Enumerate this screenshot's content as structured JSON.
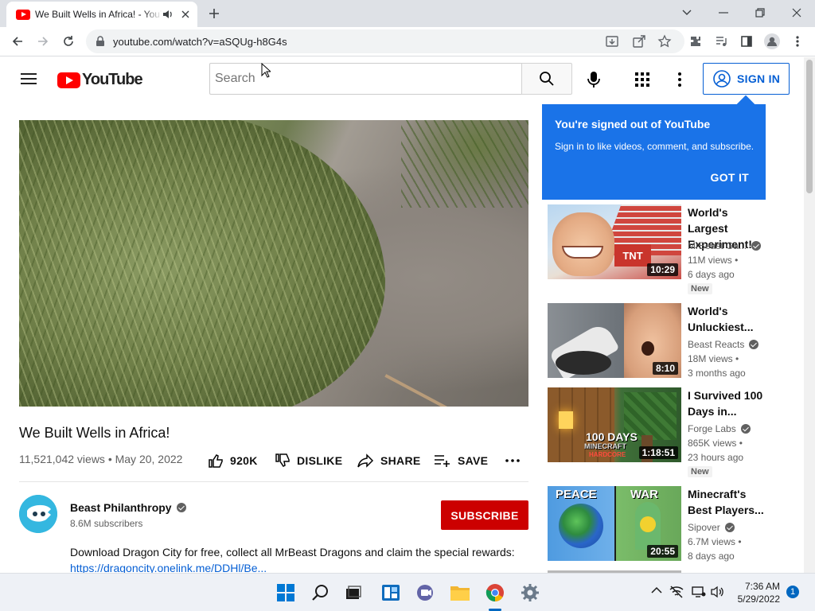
{
  "browser": {
    "tab_title": "We Built Wells in Africa! - YouTube",
    "url": "youtube.com/watch?v=aSQUg-h8G4s"
  },
  "youtube": {
    "logo_text": "YouTube",
    "search_placeholder": "Search",
    "sign_in_label": "SIGN IN"
  },
  "tooltip": {
    "heading": "You're signed out of YouTube",
    "body": "Sign in to like videos, comment, and subscribe.",
    "button": "GOT IT"
  },
  "video": {
    "title": "We Built Wells in Africa!",
    "meta": "11,521,042 views • May 20, 2022",
    "likes": "920K",
    "dislike_label": "DISLIKE",
    "share_label": "SHARE",
    "save_label": "SAVE",
    "channel": "Beast Philanthropy",
    "subscribers": "8.6M subscribers",
    "subscribe_label": "SUBSCRIBE",
    "description": "Download Dragon City for free, collect all MrBeast Dragons and claim the special rewards:",
    "description_link": "https://dragoncity.onelink.me/DDHl/Be..."
  },
  "recommendations": [
    {
      "title": "World's Largest Experiment!",
      "channel": "MrBeast Ga...",
      "views": "11M views •",
      "age": "6 days ago",
      "badge": "New",
      "duration": "10:29"
    },
    {
      "title": "World's Unluckiest...",
      "channel": "Beast Reacts",
      "views": "18M views •",
      "age": "3 months ago",
      "badge": "",
      "duration": "8:10"
    },
    {
      "title": "I Survived 100 Days in...",
      "channel": "Forge Labs",
      "views": "865K views •",
      "age": "23 hours ago",
      "badge": "New",
      "duration": "1:18:51"
    },
    {
      "title": "Minecraft's Best Players...",
      "channel": "Sipover",
      "views": "6.7M views •",
      "age": "8 days ago",
      "badge": "",
      "duration": "20:55"
    }
  ],
  "thumb_text": {
    "tnt": "TNT",
    "days_100": "100 DAYS",
    "minecraft": "MINECRAFT",
    "hardcore": "HARDCORE",
    "peace": "PEACE",
    "war": "WAR"
  },
  "taskbar": {
    "time": "7:36 AM",
    "date": "5/29/2022",
    "notifications": "1"
  },
  "colors": {
    "youtube_red": "#ff0000",
    "link_blue": "#065fd4",
    "tooltip_blue": "#1a73e8",
    "subscribe_red": "#cc0000"
  }
}
